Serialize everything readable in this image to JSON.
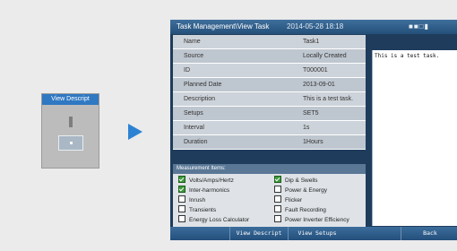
{
  "mini_button": {
    "label": "View Descript"
  },
  "titlebar": {
    "title": "Task Management\\View Task",
    "datetime": "2014-05-28 18:18",
    "status_icons": "■■□▮"
  },
  "properties": [
    {
      "label": "Name",
      "value": "Task1"
    },
    {
      "label": "Source",
      "value": "Locally Created"
    },
    {
      "label": "ID",
      "value": "T000001"
    },
    {
      "label": "Planned Date",
      "value": "2013-09-01"
    },
    {
      "label": "Description",
      "value": "This is a test task."
    },
    {
      "label": "Setups",
      "value": "SET5"
    },
    {
      "label": "Interval",
      "value": "1s"
    },
    {
      "label": "Duration",
      "value": "1Hours"
    }
  ],
  "description_text": "This is a test task.",
  "measurement": {
    "header": "Measurement Items:",
    "items": [
      {
        "label": "Volts/Amps/Hertz",
        "checked": true
      },
      {
        "label": "Dip & Swells",
        "checked": true
      },
      {
        "label": "Inter-harmonics",
        "checked": true
      },
      {
        "label": "Power & Energy",
        "checked": false
      },
      {
        "label": "Inrush",
        "checked": false
      },
      {
        "label": "Flicker",
        "checked": false
      },
      {
        "label": "Transients",
        "checked": false
      },
      {
        "label": "Fault Recording",
        "checked": false
      },
      {
        "label": "Energy Loss Calculator",
        "checked": false
      },
      {
        "label": "Power Inverter Efficiency",
        "checked": false
      }
    ]
  },
  "softkeys": {
    "view_descript": "View Descript",
    "view_setups": "View Setups",
    "back": "Back"
  },
  "colors": {
    "accent": "#2d82d4",
    "titlebar": "#2f5f8c",
    "checked": "#3e9a3c"
  }
}
